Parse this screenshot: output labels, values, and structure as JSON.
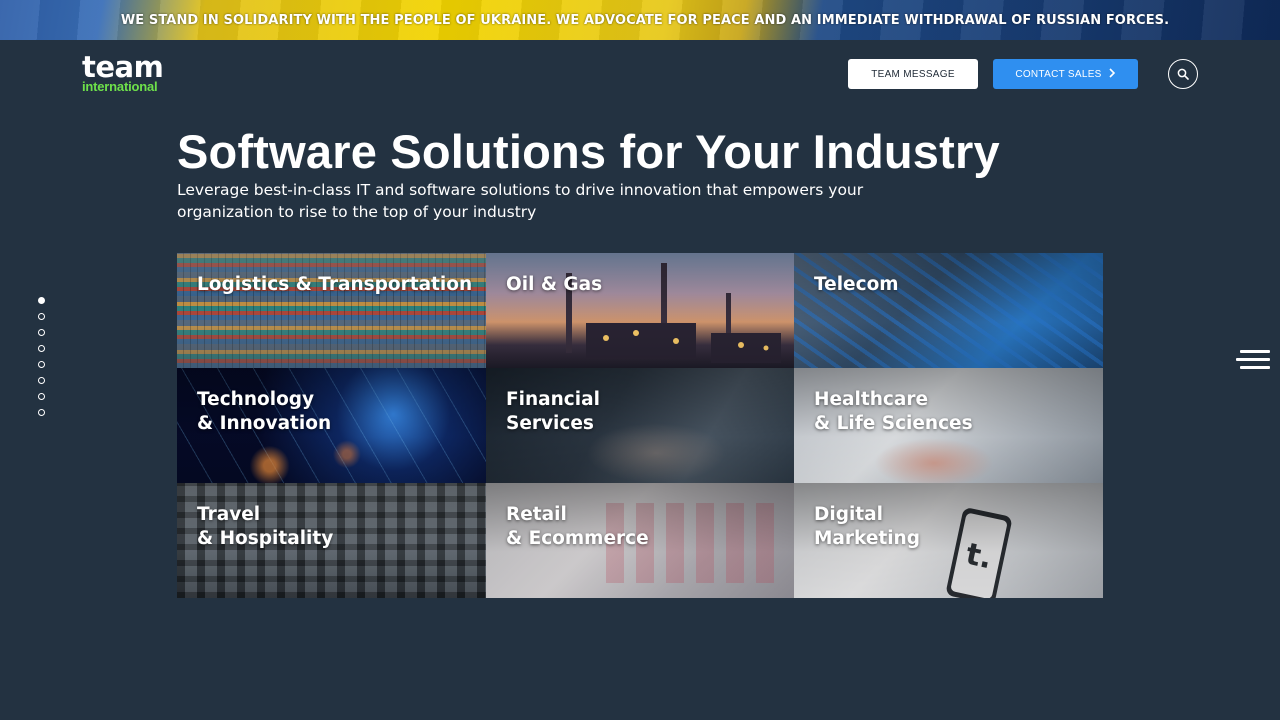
{
  "banner": {
    "text": "WE STAND IN SOLIDARITY WITH THE PEOPLE OF UKRAINE. WE ADVOCATE FOR PEACE AND AN IMMEDIATE WITHDRAWAL OF RUSSIAN FORCES."
  },
  "header": {
    "logo_main": "team",
    "logo_sub": "international",
    "team_message_label": "TEAM MESSAGE",
    "contact_sales_label": "CONTACT SALES",
    "accent_color": "#2f8ff0",
    "logo_accent_color": "#6ee14a"
  },
  "hero": {
    "title": "Software Solutions for Your Industry",
    "subtitle": "Leverage best-in-class IT and software solutions to drive innovation that empowers your organization to rise to the top of your industry"
  },
  "side_nav": {
    "dot_count": 8,
    "active_index": 0
  },
  "industries": [
    {
      "label": "Logistics & Transportation"
    },
    {
      "label": "Oil & Gas"
    },
    {
      "label": "Telecom"
    },
    {
      "label": "Technology\n& Innovation"
    },
    {
      "label": "Financial\nServices"
    },
    {
      "label": "Healthcare\n& Life Sciences"
    },
    {
      "label": "Travel\n& Hospitality"
    },
    {
      "label": "Retail\n& Ecommerce"
    },
    {
      "label": "Digital\nMarketing"
    }
  ],
  "decor": {
    "phone_glyph": "t."
  },
  "icons": {
    "search": "search-icon",
    "menu": "hamburger-menu-icon",
    "chevron": "chevron-right-icon"
  }
}
